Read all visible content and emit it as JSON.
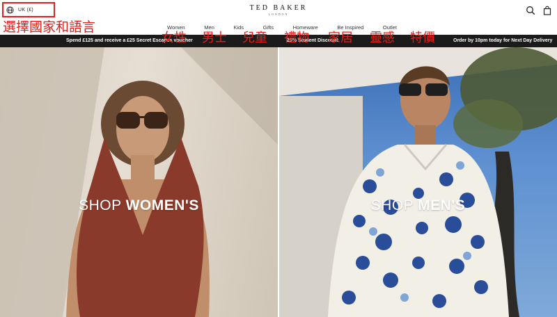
{
  "header": {
    "locale_label": "UK (£)",
    "brand_name": "TED BAKER",
    "brand_sub": "LONDON",
    "nav": [
      "Women",
      "Men",
      "Kids",
      "Gifts",
      "Homeware",
      "Be Inspired",
      "Outlet"
    ],
    "icons": [
      "globe-icon",
      "search-icon",
      "bag-icon"
    ]
  },
  "overlay": {
    "locale_cjk": "選擇國家和語言",
    "nav_cjk": [
      "女性",
      "男士",
      "兒童",
      "禮物",
      "家居",
      "靈感",
      "特價"
    ]
  },
  "promo": {
    "left": "Spend £125 and receive a £25 Secret Escapes voucher",
    "center": "25% Student Discount",
    "right": "Order by 10pm today for Next Day Delivery"
  },
  "hero": {
    "women": {
      "light": "SHOP ",
      "bold": "WOMEN'S"
    },
    "men": {
      "light": "SHOP ",
      "bold": "MEN'S"
    }
  },
  "colors": {
    "overlay_red": "#e0211b",
    "promo_bg": "#1b1b1b"
  }
}
